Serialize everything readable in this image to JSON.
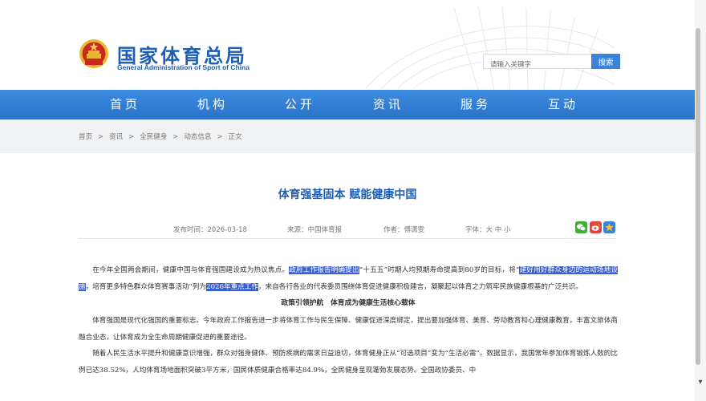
{
  "header": {
    "site_name": "国家体育总局",
    "site_name_en": "General Administration of Sport of China",
    "search_placeholder": "请输入关键字",
    "search_button": "搜索"
  },
  "nav": {
    "items": [
      "首页",
      "机构",
      "公开",
      "资讯",
      "服务",
      "互动"
    ]
  },
  "breadcrumb": {
    "items": [
      "首页",
      "资讯",
      "全民健身",
      "动态信息",
      "正文"
    ],
    "separator": ">"
  },
  "article": {
    "title": "体育强基固本 赋能健康中国",
    "publish_label": "发布时间：",
    "publish_date": "2026-03-18",
    "source_label": "来源：",
    "source": "中国体育报",
    "author_label": "作者：",
    "author": "傅潇雯",
    "font_label": "字体：",
    "font_sizes": [
      "大",
      "中",
      "小"
    ],
    "p1_a": "在今年全国两会期间，健康中国与体育强国建设成为热议焦点。",
    "p1_hl1": "政府工作报告明确提出",
    "p1_b": "“十五五”时期人均预期寿命提高到80岁的目标，将“",
    "p1_hl2": "建好用好群众身边的运动场地设施",
    "p1_c": "，培育更多特色群众体育赛事活动”列为",
    "p1_hl3": "2026年重点工作",
    "p1_d": "，来自各行各业的代表委员围绕体育促进健康积极建言，凝聚起以体育之力筑牢民族健康根基的广泛共识。",
    "subheading": "政策引领护航　体育成为健康生活核心载体",
    "p2": "体育强国是现代化强国的重要标志。今年政府工作报告进一步将体育工作与民生保障、健康促进深度绑定，提出要加强体育、美育、劳动教育和心理健康教育，丰富文旅体商融合业态，让体育成为全生命周期健康促进的重要途径。",
    "p3": "随着人民生活水平提升和健康意识增强，群众对强身健体、预防疾病的需求日益迫切，体育健身正从“可选项目”变为“生活必需”。数据显示，我国常年参加体育锻炼人数的比例已达38.52%，人均体育场地面积突破3平方米，国民体质健康合格率达84.9%，全民健身呈现蓬勃发展态势。全国政协委员、中"
  },
  "colors": {
    "brand_blue": "#1f5fb3",
    "nav_blue": "#2f7dd6",
    "highlight": "#3a5fd0"
  }
}
